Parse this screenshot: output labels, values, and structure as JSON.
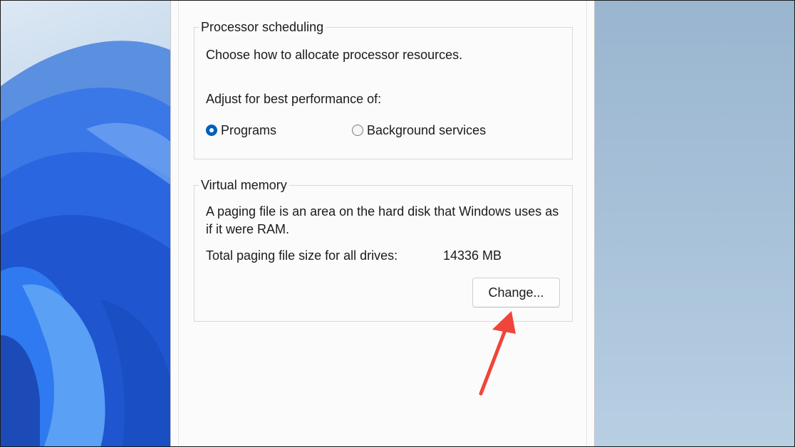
{
  "processor_scheduling": {
    "title": "Processor scheduling",
    "description": "Choose how to allocate processor resources.",
    "adjust_label": "Adjust for best performance of:",
    "options": [
      {
        "label": "Programs",
        "selected": true
      },
      {
        "label": "Background services",
        "selected": false
      }
    ]
  },
  "virtual_memory": {
    "title": "Virtual memory",
    "description_line1": "A paging file is an area on the hard disk that Windows uses as",
    "description_line2": "if it were RAM.",
    "total_label": "Total paging file size for all drives:",
    "total_value": "14336 MB",
    "change_button": "Change..."
  },
  "colors": {
    "accent": "#005fb8",
    "annotation_arrow": "#f0453a",
    "dialog_background": "#fbfbfb"
  },
  "icons": [
    "radio-selected",
    "radio-unselected",
    "annotation-arrow"
  ]
}
